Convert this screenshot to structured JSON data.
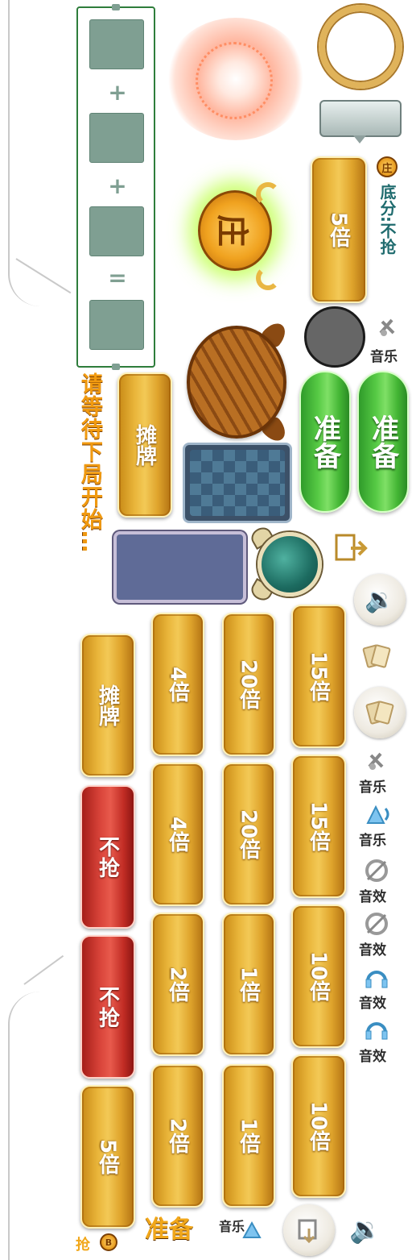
{
  "formula": {
    "plus1": "+",
    "plus2": "+",
    "equals": "="
  },
  "wait_message": "请等待下局开始…",
  "buttons": {
    "show_cards_top": "摊牌",
    "show_cards_bottom": "摊牌",
    "multiplier_5_top": "5倍",
    "multiplier_5_bottom": "5倍",
    "ready_1": "准备",
    "ready_2": "准备",
    "no_grab_1": "不抢",
    "no_grab_2": "不抢"
  },
  "multiplier_grid": {
    "col_right": [
      "15倍",
      "15倍",
      "10倍",
      "10倍"
    ],
    "col_middle": [
      "20倍",
      "20倍",
      "1倍",
      "1倍"
    ],
    "col_left": [
      "4倍",
      "4倍",
      "2倍",
      "2倍"
    ]
  },
  "badge": {
    "banker_glyph": "庄",
    "small_coin_glyph": "庄",
    "small_coin_glyph_bottom": "B"
  },
  "base_score": "底分:不抢",
  "side_labels": {
    "music_1": "音乐",
    "music_2": "音乐",
    "music_3": "音乐",
    "music_4": "音乐",
    "effect_1": "音效",
    "effect_2": "音效",
    "effect_3": "音效",
    "effect_4": "音效"
  },
  "ready_label": "准备",
  "grab_label": "抢",
  "icons": {
    "speaker": "speaker-icon",
    "exit": "exit-door-icon",
    "cards": "cards-icon",
    "music_mute": "music-mute-icon",
    "music_on": "music-on-icon",
    "effect_mute": "effect-mute-icon",
    "effect_on": "effect-on-icon",
    "alarm": "alarm-clock-icon",
    "bull": "bull-head-icon"
  },
  "colors": {
    "gold": "#e9b53a",
    "red": "#d9443a",
    "green": "#56c944",
    "wait_text": "#f19a10",
    "formula_border": "#2e7d3b"
  }
}
